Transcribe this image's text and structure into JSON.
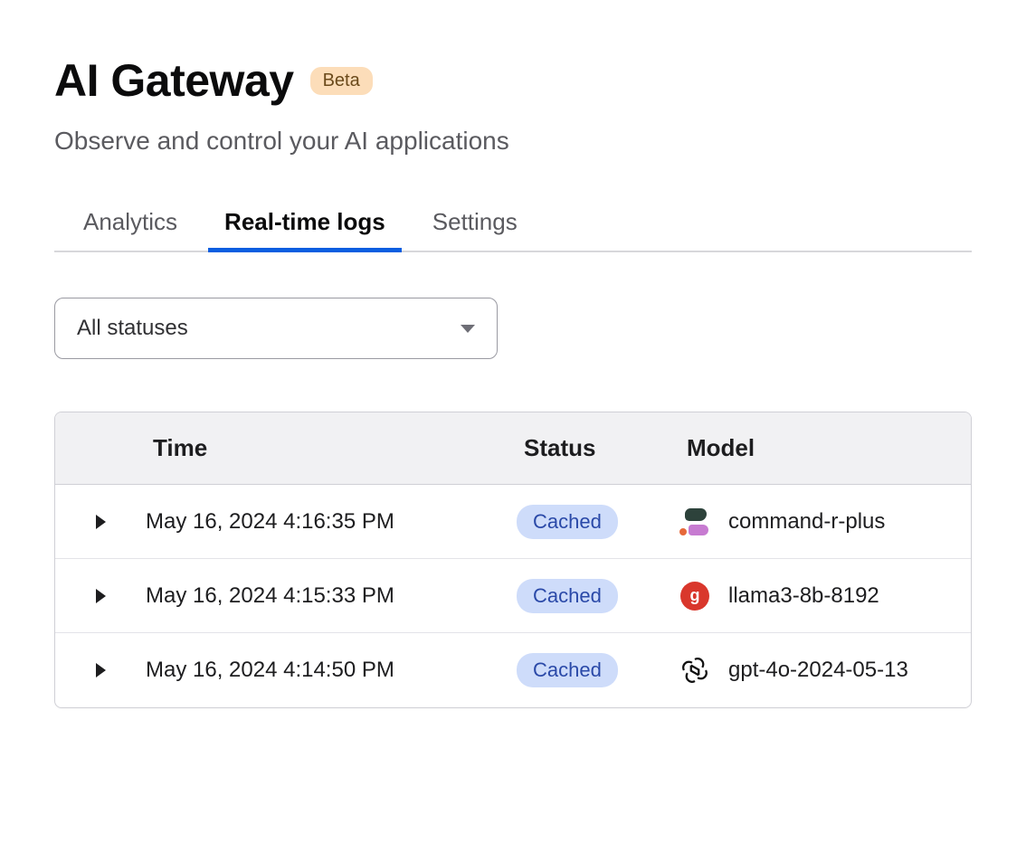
{
  "header": {
    "title": "AI Gateway",
    "badge": "Beta",
    "subtitle": "Observe and control your AI applications"
  },
  "tabs": [
    {
      "id": "analytics",
      "label": "Analytics",
      "active": false
    },
    {
      "id": "realtime-logs",
      "label": "Real-time logs",
      "active": true
    },
    {
      "id": "settings",
      "label": "Settings",
      "active": false
    }
  ],
  "filter": {
    "status_select": {
      "value": "All statuses"
    }
  },
  "table": {
    "columns": {
      "time": "Time",
      "status": "Status",
      "model": "Model"
    },
    "rows": [
      {
        "time": "May 16, 2024 4:16:35 PM",
        "status": "Cached",
        "model": "command-r-plus",
        "vendor": "cohere"
      },
      {
        "time": "May 16, 2024 4:15:33 PM",
        "status": "Cached",
        "model": "llama3-8b-8192",
        "vendor": "groq"
      },
      {
        "time": "May 16, 2024 4:14:50 PM",
        "status": "Cached",
        "model": "gpt-4o-2024-05-13",
        "vendor": "openai"
      }
    ]
  }
}
